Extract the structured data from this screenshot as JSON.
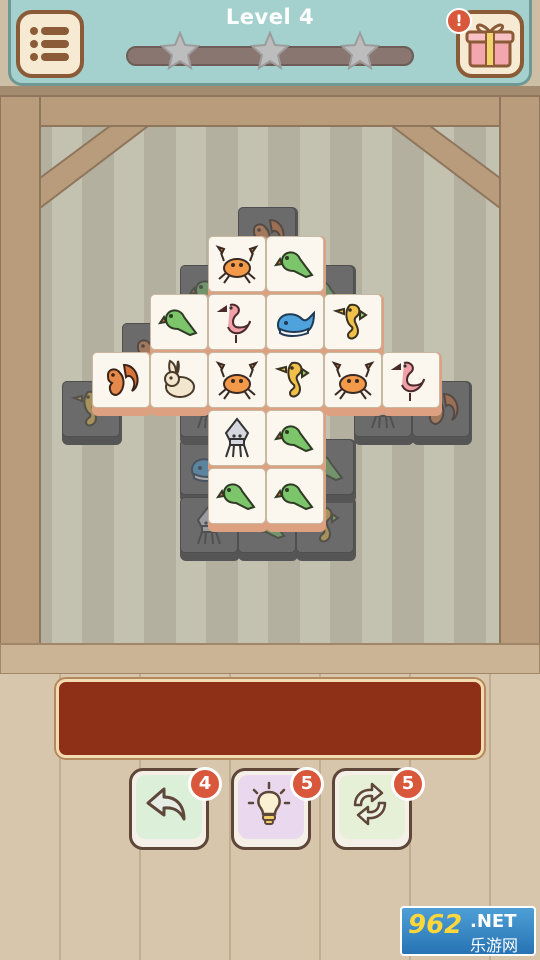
{
  "header": {
    "level_title": "Level 4",
    "stars_total": 3,
    "stars_earned": 0,
    "progress_fraction": 0.0,
    "menu_icon": "list-icon",
    "gift_icon": "gift-icon",
    "gift_alert": "!"
  },
  "board": {
    "tiles": [
      {
        "animal": "squirrel",
        "layer": 0
      },
      {
        "animal": "parrot",
        "layer": 0
      },
      {
        "animal": "parrot",
        "layer": 0
      },
      {
        "animal": "squirrel",
        "layer": 0
      },
      {
        "animal": "whale",
        "layer": 0
      },
      {
        "animal": "squid",
        "layer": 0
      },
      {
        "animal": "seahorse",
        "layer": 0
      },
      {
        "animal": "squid",
        "layer": 0
      },
      {
        "animal": "squirrel",
        "layer": 0
      },
      {
        "animal": "crab",
        "layer": 1
      },
      {
        "animal": "parrot",
        "layer": 1
      },
      {
        "animal": "parrot",
        "layer": 1
      },
      {
        "animal": "flamingo",
        "layer": 1
      },
      {
        "animal": "whale",
        "layer": 1
      },
      {
        "animal": "seahorse",
        "layer": 1
      },
      {
        "animal": "squirrel",
        "layer": 1
      },
      {
        "animal": "rabbit",
        "layer": 1
      },
      {
        "animal": "crab",
        "layer": 1
      },
      {
        "animal": "seahorse",
        "layer": 1
      },
      {
        "animal": "crab",
        "layer": 1
      },
      {
        "animal": "flamingo",
        "layer": 1
      },
      {
        "animal": "squid",
        "layer": 1
      },
      {
        "animal": "parrot",
        "layer": 1
      },
      {
        "animal": "parrot",
        "layer": 1
      },
      {
        "animal": "parrot",
        "layer": 1
      }
    ]
  },
  "tray": {
    "slots": 7,
    "filled": 0
  },
  "tools": [
    {
      "name": "undo",
      "icon": "undo-arrow-icon",
      "count": "4",
      "color": "#dcefd9"
    },
    {
      "name": "hint",
      "icon": "lightbulb-icon",
      "count": "5",
      "color": "#ead8ef"
    },
    {
      "name": "shuffle",
      "icon": "shuffle-icon",
      "count": "5",
      "color": "#e6f0d6"
    }
  ],
  "watermark": {
    "number": "962",
    "domain": ".NET",
    "chinese": "乐游网"
  },
  "colors": {
    "header_bg": "#a4d1cd",
    "tray_bg": "#8e2f18",
    "badge_red": "#d9573a",
    "star_gray": "#b8b8b8"
  }
}
